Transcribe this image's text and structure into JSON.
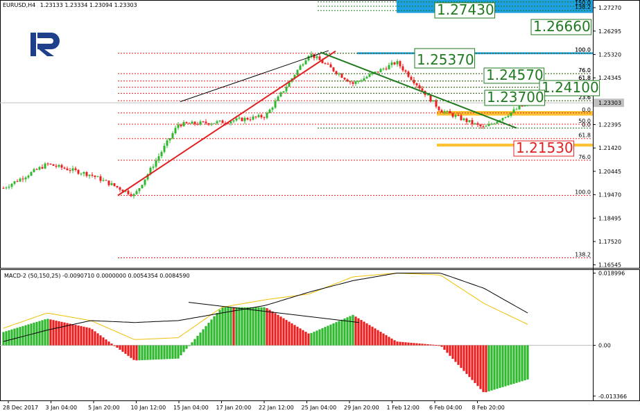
{
  "header": {
    "symbol_info": "EURUSD,H4",
    "ohlc": "1.23133 1.23334 1.23094 1.23303"
  },
  "macd_header": "MACD-2 (50,150,25) -0.0090710 0.0000000 0.0054354 0.0084590",
  "colors": {
    "bull": "#2eb82e",
    "bear": "#e62020",
    "fib_red": "#e02020",
    "fib_green": "#1f7a1f",
    "target_blue": "#1ea0e0",
    "target_orange": "#ffc233",
    "macd_signal": "#f0c000",
    "macd_main": "#000000"
  },
  "price_axis": {
    "ticks": [
      "1.27270",
      "1.26295",
      "1.25320",
      "1.24345",
      "1.23370",
      "1.22395",
      "1.21420",
      "1.20445",
      "1.19470",
      "1.18495",
      "1.17520",
      "1.16545"
    ],
    "ymin": 1.1642,
    "ymax": 1.2759,
    "current_price": "1.23303"
  },
  "macd_axis": {
    "ticks": [
      "0.018996",
      "0.00",
      "-0.013366"
    ],
    "ymin": -0.0145,
    "ymax": 0.02
  },
  "time_axis": {
    "labels": [
      "28 Dec 2017",
      "3 Jan 04:00",
      "5 Jan 20:00",
      "10 Jan 12:00",
      "15 Jan 04:00",
      "17 Jan 20:00",
      "22 Jan 12:00",
      "25 Jan 04:00",
      "29 Jan 20:00",
      "1 Feb 12:00",
      "6 Feb 04:00",
      "8 Feb 20:00"
    ]
  },
  "fib_red": {
    "levels": [
      {
        "label": "0.0",
        "price": 1.2288
      },
      {
        "label": "23.6",
        "price": 1.2339
      },
      {
        "label": "38.2",
        "price": 1.237
      },
      {
        "label": "50.0",
        "price": 1.2395
      },
      {
        "label": "61.8",
        "price": 1.2421
      },
      {
        "label": "76.0",
        "price": 1.2452
      },
      {
        "label": "100.0",
        "price": 1.2537
      },
      {
        "label": "50.0",
        "price": 1.2241
      },
      {
        "label": "61.8",
        "price": 1.2181
      },
      {
        "label": "76.0",
        "price": 1.2091
      },
      {
        "label": "100.0",
        "price": 1.1944
      },
      {
        "label": "138.2",
        "price": 1.1684
      }
    ]
  },
  "fib_green": {
    "levels": [
      {
        "label": "161.8",
        "price": 1.2751
      },
      {
        "label": "150.0",
        "price": 1.2733
      },
      {
        "label": "138.2",
        "price": 1.2715
      },
      {
        "label": "100.0",
        "price": 1.2537
      },
      {
        "label": "76.0",
        "price": 1.2452
      },
      {
        "label": "61.8",
        "price": 1.2421
      },
      {
        "label": "50.0",
        "price": 1.2395
      },
      {
        "label": "38.2",
        "price": 1.237
      },
      {
        "label": "23.6",
        "price": 1.2339
      },
      {
        "label": "0.0",
        "price": 1.2225
      }
    ]
  },
  "target_labels": [
    {
      "text": "1.27430",
      "price": 1.2743,
      "color": "green"
    },
    {
      "text": "1.26660",
      "price": 1.2666,
      "color": "green"
    },
    {
      "text": "1.25370",
      "price": 1.2537,
      "color": "green"
    },
    {
      "text": "1.24570",
      "price": 1.2457,
      "color": "green"
    },
    {
      "text": "1.24100",
      "price": 1.241,
      "color": "green"
    },
    {
      "text": "1.23700",
      "price": 1.237,
      "color": "green"
    },
    {
      "text": "1.21530",
      "price": 1.2153,
      "color": "red"
    }
  ],
  "chart_data": {
    "type": "candlestick",
    "title": "EURUSD,H4",
    "current_price": 1.23303,
    "price_anchors": [
      {
        "time": "28 Dec 2017",
        "price": 1.1975
      },
      {
        "time": "3 Jan 04:00",
        "price": 1.2075
      },
      {
        "time": "5 Jan 20:00",
        "price": 1.203
      },
      {
        "time": "10 Jan 12:00",
        "price": 1.1944
      },
      {
        "time": "15 Jan 04:00",
        "price": 1.224
      },
      {
        "time": "17 Jan 20:00",
        "price": 1.225
      },
      {
        "time": "22 Jan 12:00",
        "price": 1.2275
      },
      {
        "time": "25 Jan 04:00",
        "price": 1.2537
      },
      {
        "time": "29 Jan 20:00",
        "price": 1.241
      },
      {
        "time": "1 Feb 12:00",
        "price": 1.25
      },
      {
        "time": "6 Feb 04:00",
        "price": 1.23
      },
      {
        "time": "8 Feb 20:00",
        "price": 1.2225
      },
      {
        "time": "8 Feb 20:00",
        "price": 1.233
      }
    ],
    "macd_histogram_anchors": [
      0.0035,
      0.007,
      0.0045,
      -0.004,
      -0.0035,
      0.01,
      0.01,
      0.003,
      0.008,
      0.001,
      0.0,
      -0.0125,
      -0.009
    ],
    "macd_signal_anchors": [
      0.0045,
      0.0085,
      0.0065,
      0.0015,
      0.002,
      0.01,
      0.012,
      0.0135,
      0.018,
      0.019,
      0.0185,
      0.011,
      0.0055
    ],
    "macd_main_anchors": [
      0.001,
      0.004,
      0.0065,
      0.006,
      0.0065,
      0.0085,
      0.0105,
      0.014,
      0.017,
      0.019,
      0.019,
      0.015,
      0.0085
    ]
  }
}
